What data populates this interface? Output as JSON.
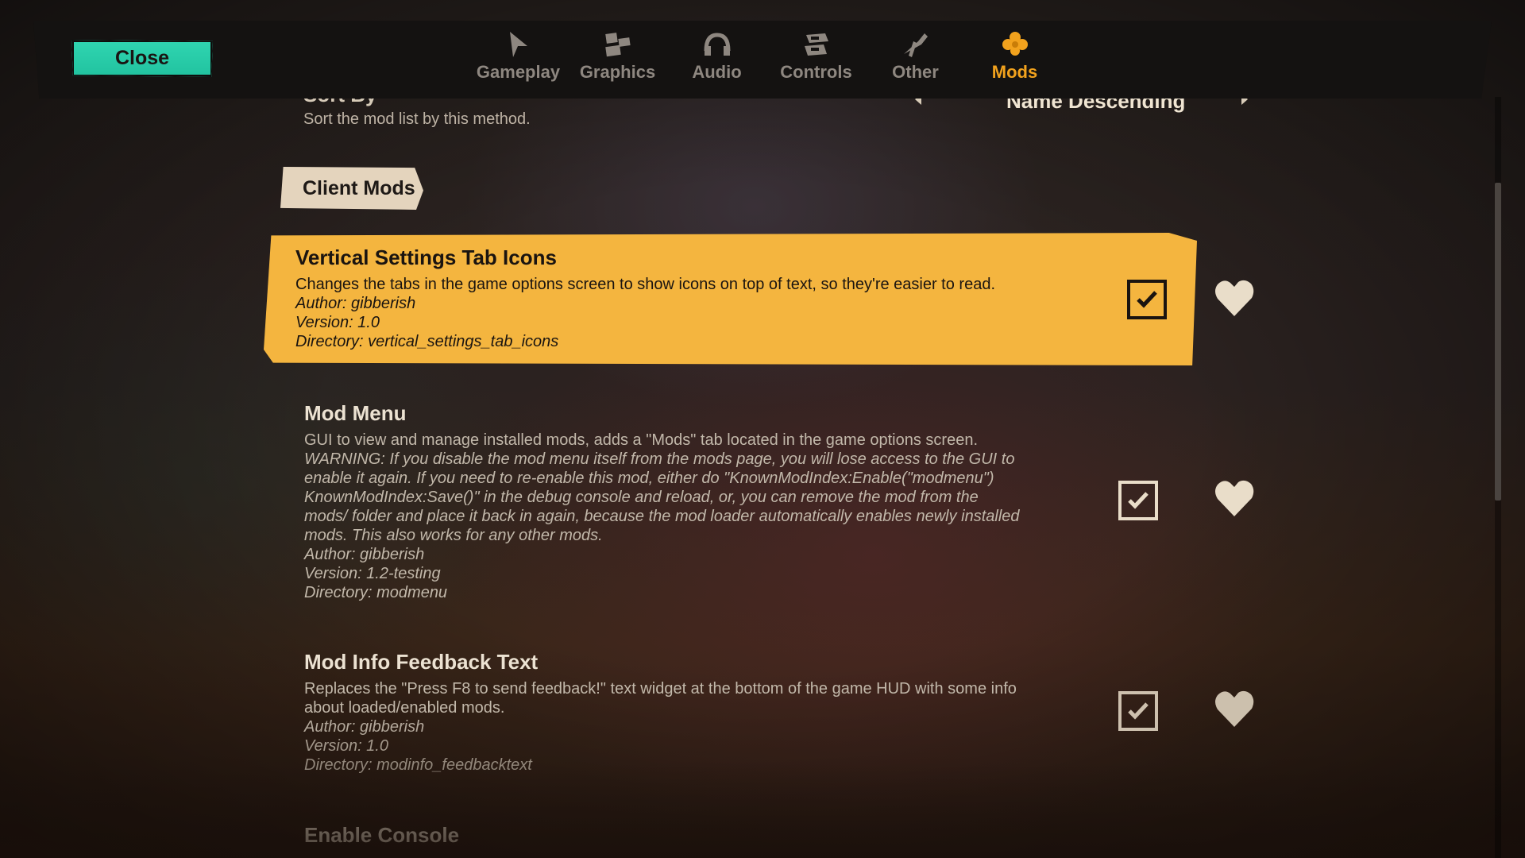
{
  "header": {
    "close_label": "Close",
    "tabs": [
      {
        "label": "Gameplay",
        "icon": "flag-icon"
      },
      {
        "label": "Graphics",
        "icon": "blocks-icon"
      },
      {
        "label": "Audio",
        "icon": "headphones-icon"
      },
      {
        "label": "Controls",
        "icon": "controls-icon"
      },
      {
        "label": "Other",
        "icon": "horn-icon"
      },
      {
        "label": "Mods",
        "icon": "clover-icon"
      }
    ],
    "active_tab": "Mods",
    "colors": {
      "active": "#f2a21d",
      "inactive": "#8e8780",
      "close_button": "#26c9a5"
    }
  },
  "sort": {
    "title": "Sort By",
    "description": "Sort the mod list by this method.",
    "value": "Name Descending"
  },
  "section": {
    "label": "Client Mods"
  },
  "mods": [
    {
      "title": "Vertical Settings Tab Icons",
      "description": "Changes the tabs in the game options screen to show icons on top of text, so they're easier to read.",
      "author": "Author: gibberish",
      "version": "Version: 1.0",
      "directory": "Directory: vertical_settings_tab_icons",
      "enabled": true,
      "selected": true
    },
    {
      "title": "Mod Menu",
      "description": "GUI to view and manage installed mods, adds a \"Mods\" tab located in the game options screen.",
      "warning_lines": [
        "WARNING: If you disable the mod menu itself from the mods page, you will lose access to the GUI to",
        "enable it again. If you need to re-enable this mod, either do \"KnownModIndex:Enable(\"modmenu\")",
        "KnownModIndex:Save()\" in the debug console and reload, or, you can remove the mod from the",
        "mods/ folder and place it back in again, because the mod loader automatically enables newly installed",
        "mods. This also works for any other mods."
      ],
      "author": "Author: gibberish",
      "version": "Version: 1.2-testing",
      "directory": "Directory: modmenu",
      "enabled": true
    },
    {
      "title": "Mod Info Feedback Text",
      "description_lines": [
        "Replaces the \"Press F8 to send feedback!\" text widget at the bottom of the game HUD with some info",
        "about loaded/enabled mods."
      ],
      "author": "Author: gibberish",
      "version": "Version: 1.0",
      "directory": "Directory: modinfo_feedbacktext",
      "enabled": true
    },
    {
      "title": "Enable Console"
    }
  ]
}
